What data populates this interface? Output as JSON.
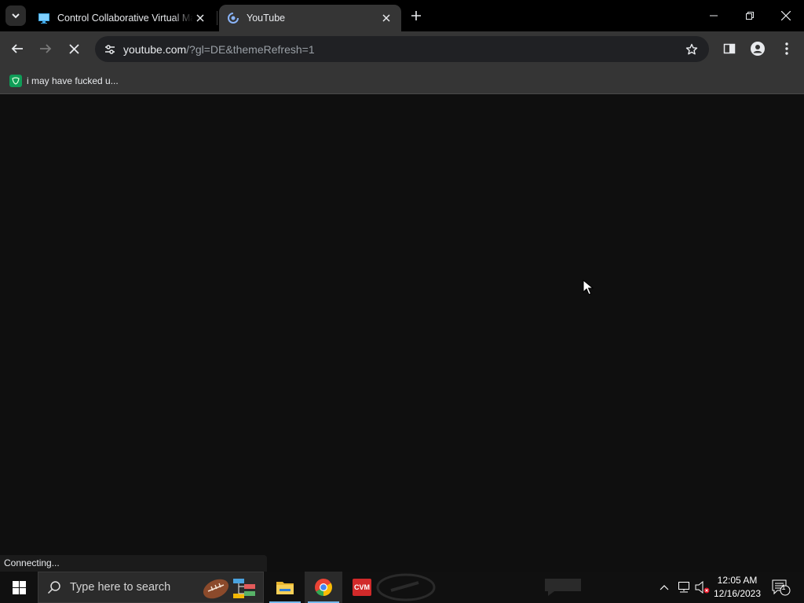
{
  "browser": {
    "tabs": [
      {
        "title": "Control Collaborative Virtual Machine",
        "favicon": "monitor-icon",
        "active": false
      },
      {
        "title": "YouTube",
        "favicon": "loading-spinner-icon",
        "active": true
      }
    ],
    "address_bar": {
      "url_host": "youtube.com",
      "url_rest": "/?gl=DE&themeRefresh=1"
    },
    "bookmarks": [
      {
        "label": "i may have fucked u...",
        "icon": "bookmark-favicon-icon"
      }
    ],
    "status_text": "Connecting..."
  },
  "taskbar": {
    "search_placeholder": "Type here to search",
    "apps": [
      "file-explorer-icon",
      "chrome-icon",
      "collabvm-icon"
    ],
    "clock": {
      "time": "12:05 AM",
      "date": "12/16/2023"
    },
    "notification_count": "1"
  },
  "colors": {
    "tabstrip": "#000000",
    "toolbar": "#353535",
    "omnibox": "#202124",
    "content": "#0f0f0f",
    "taskbar": "#101010"
  }
}
